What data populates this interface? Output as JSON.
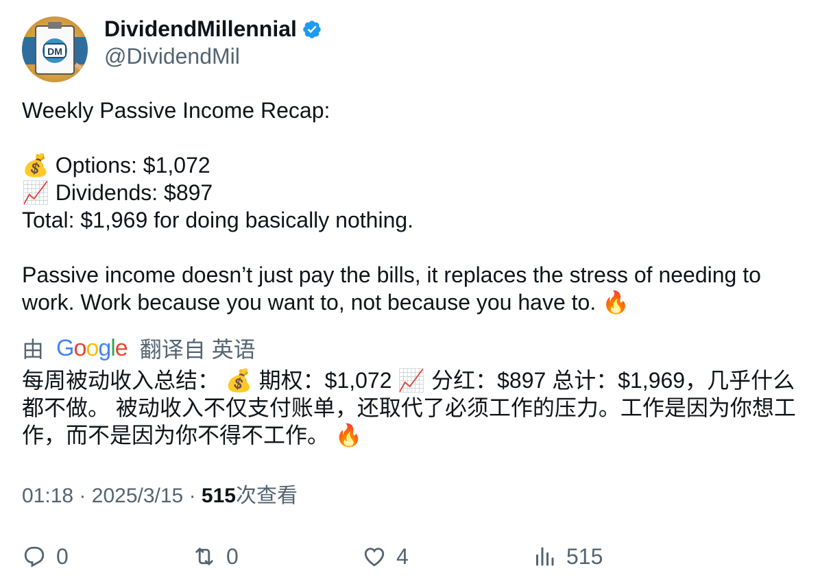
{
  "author": {
    "display_name": "DividendMillennial",
    "handle": "@DividendMil",
    "verified": true,
    "avatar_initials": "DM",
    "verified_color": "#1d9bf0"
  },
  "tweet": {
    "lines": [
      "Weekly Passive Income Recap:",
      "",
      "💰 Options: $1,072",
      "📈 Dividends: $897",
      "Total: $1,969 for doing basically nothing.",
      "",
      "Passive income doesn’t just pay the bills, it replaces the stress of needing to work. Work because you want to, not because you have to. 🔥"
    ]
  },
  "translation": {
    "prefix": "由",
    "provider": "Google",
    "suffix": "翻译自 英语",
    "text": "每周被动收入总结： 💰 期权：$1,072 📈 分红：$897 总计：$1,969，几乎什么都不做。 被动收入不仅支付账单，还取代了必须工作的压力。工作是因为你想工作，而不是因为你不得不工作。 🔥"
  },
  "meta": {
    "time": "01:18",
    "date": "2025/3/15",
    "separator": "·",
    "views_count": "515",
    "views_label": "次查看"
  },
  "actions": {
    "reply": {
      "icon": "reply-icon",
      "count": "0"
    },
    "retweet": {
      "icon": "retweet-icon",
      "count": "0"
    },
    "like": {
      "icon": "heart-icon",
      "count": "4"
    },
    "views": {
      "icon": "analytics-icon",
      "count": "515"
    }
  },
  "colors": {
    "text": "#0f1419",
    "secondary": "#536471",
    "accent": "#1d9bf0"
  }
}
